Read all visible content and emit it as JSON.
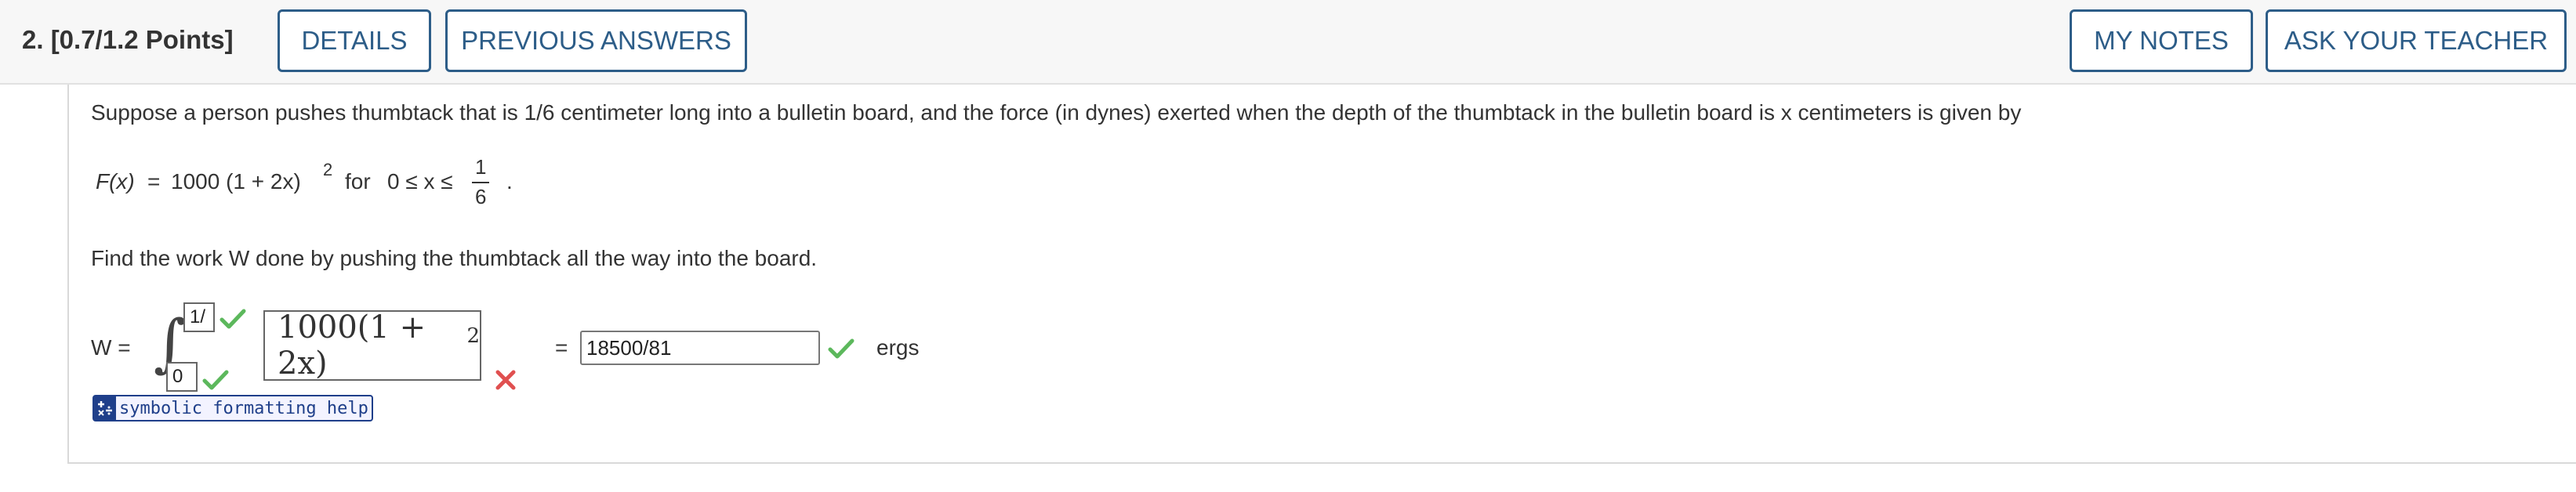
{
  "header": {
    "question_label": "2.  [0.7/1.2 Points]",
    "details_button": "DETAILS",
    "previous_answers_button": "PREVIOUS ANSWERS",
    "my_notes_button": "MY NOTES",
    "ask_teacher_button": "ASK YOUR TEACHER"
  },
  "question": {
    "prompt": "Suppose a person pushes thumbtack that is 1/6 centimeter long into a bulletin board, and the force (in dynes) exerted when the depth of the thumbtack in the bulletin board is x centimeters is given by",
    "function": {
      "lhs": "F(x)",
      "equals": "=",
      "expr": "1000 (1 + 2x)",
      "exponent": "2",
      "for_word": "for",
      "domain": "0 ≤ x ≤",
      "frac_num": "1",
      "frac_den": "6",
      "period": "."
    },
    "find_text": "Find the work W done by pushing the thumbtack all the way into the board."
  },
  "answer": {
    "w_label": "W =",
    "upper_bound": "1/",
    "lower_bound": "0",
    "integrand": "1000(1 + 2x)",
    "integrand_exp": "2",
    "equals": "=",
    "value": "18500/81",
    "units": "ergs",
    "symbolic_help": "symbolic formatting help"
  },
  "colors": {
    "button_border": "#2d5d88",
    "correct": "#5cb85c",
    "incorrect": "#e05050",
    "help_blue": "#1f3f8a"
  }
}
